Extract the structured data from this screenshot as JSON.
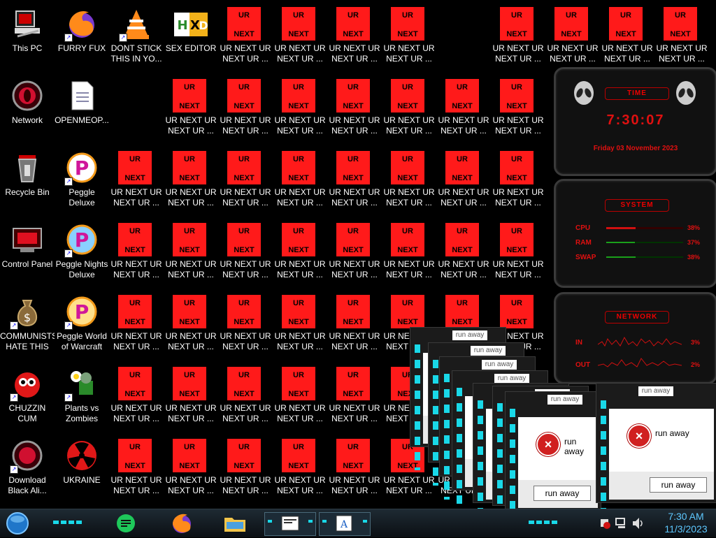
{
  "desktop": {
    "left_column": [
      {
        "label": "This PC",
        "icon": "computer-icon"
      },
      {
        "label": "Network",
        "icon": "network-icon"
      },
      {
        "label": "Recycle Bin",
        "icon": "recycle-bin-icon"
      },
      {
        "label": "Control Panel",
        "icon": "control-panel-icon"
      },
      {
        "label": "COMMUNISTS HATE THIS G...",
        "icon": "money-bag-icon"
      },
      {
        "label": "CHUZZIN CUM",
        "icon": "chuzzle-icon"
      },
      {
        "label": "Download Black Ali...",
        "icon": "alienware-icon"
      }
    ],
    "second_column": [
      {
        "label": "FURRY FUX",
        "icon": "firefox-icon"
      },
      {
        "label": "OPENMEOP...",
        "icon": "document-icon"
      },
      {
        "label": "Peggle Deluxe",
        "icon": "peggle-icon"
      },
      {
        "label": "Peggle Nights Deluxe",
        "icon": "peggle-icon"
      },
      {
        "label": "Peggle World of Warcraft",
        "icon": "peggle-icon"
      },
      {
        "label": "Plants vs Zombies",
        "icon": "plants-vs-zombies-icon"
      },
      {
        "label": "UKRAINE",
        "icon": "radiation-icon"
      }
    ],
    "top_row_extra": [
      {
        "label": "DONT STICK THIS IN YO...",
        "icon": "vlc-icon"
      },
      {
        "label": "SEX EDITOR",
        "icon": "hxd-icon"
      }
    ],
    "ur_icon": {
      "line1": "UR",
      "line2": "NEXT",
      "label": "UR NEXT UR NEXT UR ..."
    }
  },
  "gadget": {
    "time_title": "TIME",
    "time": "7:30:07",
    "date": "Friday 03 November 2023",
    "system_title": "SYSTEM",
    "cpu_label": "CPU",
    "cpu_value": "38%",
    "cpu_level": 0.38,
    "ram_label": "RAM",
    "ram_value": "37%",
    "ram_level": 0.37,
    "swap_label": "SWAP",
    "swap_value": "38%",
    "swap_level": 0.38,
    "network_title": "NETWORK",
    "in_label": "IN",
    "in_value": "3%",
    "out_label": "OUT",
    "out_value": "2%"
  },
  "dialogs": {
    "caption": "run away",
    "message": "run away",
    "button": "run away"
  },
  "taskbar": {
    "time": "7:30 AM",
    "date": "11/3/2023"
  },
  "colors": {
    "accent_red": "#ff1a1a",
    "cyan": "#19d8e8",
    "clock_blue": "#5ec8ff"
  }
}
